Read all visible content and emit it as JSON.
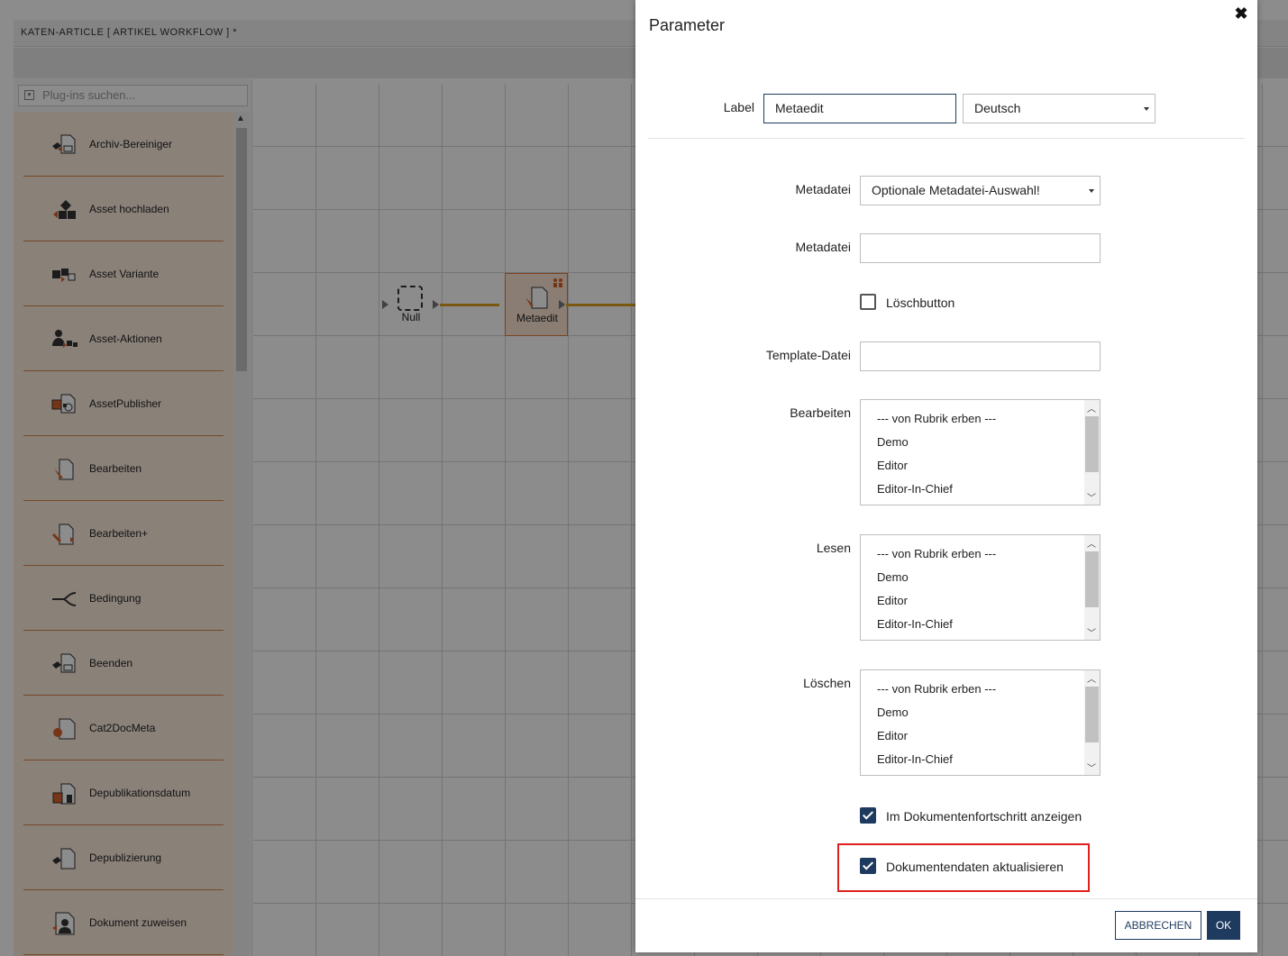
{
  "app": {
    "title": "KATEN-ARTICLE [ ARTIKEL WORKFLOW ] *"
  },
  "plugins": {
    "search_placeholder": "Plug-ins suchen...",
    "items": [
      {
        "label": "Archiv-Bereiniger",
        "icon": "archive-cleaner-icon"
      },
      {
        "label": "Asset hochladen",
        "icon": "asset-upload-icon"
      },
      {
        "label": "Asset Variante",
        "icon": "asset-variant-icon"
      },
      {
        "label": "Asset-Aktionen",
        "icon": "asset-actions-icon"
      },
      {
        "label": "AssetPublisher",
        "icon": "asset-publisher-icon"
      },
      {
        "label": "Bearbeiten",
        "icon": "edit-document-icon"
      },
      {
        "label": "Bearbeiten+",
        "icon": "edit-plus-document-icon"
      },
      {
        "label": "Bedingung",
        "icon": "condition-branch-icon"
      },
      {
        "label": "Beenden",
        "icon": "end-icon"
      },
      {
        "label": "Cat2DocMeta",
        "icon": "cat2docmeta-icon"
      },
      {
        "label": "Depublikationsdatum",
        "icon": "depublish-date-icon"
      },
      {
        "label": "Depublizierung",
        "icon": "depublish-icon"
      },
      {
        "label": "Dokument zuweisen",
        "icon": "assign-document-icon"
      }
    ]
  },
  "canvas": {
    "nodes": [
      {
        "label": "Null",
        "icon": "null-node-icon"
      },
      {
        "label": "Metaedit",
        "icon": "meta-edit-icon",
        "badge": "users-badge-icon"
      }
    ]
  },
  "dialog": {
    "title": "Parameter",
    "close_icon": "close-icon",
    "label_field": {
      "label": "Label",
      "value": "Metaedit"
    },
    "language_select": {
      "value": "Deutsch"
    },
    "metadatei_select": {
      "label": "Metadatei",
      "value": "Optionale Metadatei-Auswahl!"
    },
    "metadatei_input": {
      "label": "Metadatei",
      "value": ""
    },
    "loeschbutton": {
      "label": "Löschbutton",
      "checked": false
    },
    "template_file": {
      "label": "Template-Datei",
      "value": ""
    },
    "bearbeiten": {
      "label": "Bearbeiten",
      "options": [
        "--- von Rubrik erben ---",
        "Demo",
        "Editor",
        "Editor-In-Chief"
      ]
    },
    "lesen": {
      "label": "Lesen",
      "options": [
        "--- von Rubrik erben ---",
        "Demo",
        "Editor",
        "Editor-In-Chief"
      ]
    },
    "loeschen": {
      "label": "Löschen",
      "options": [
        "--- von Rubrik erben ---",
        "Demo",
        "Editor",
        "Editor-In-Chief"
      ]
    },
    "show_progress": {
      "label": "Im Dokumentenfortschritt anzeigen",
      "checked": true
    },
    "update_docdata": {
      "label": "Dokumentendaten aktualisieren",
      "checked": true
    },
    "cancel_label": "ABBRECHEN",
    "ok_label": "OK"
  },
  "colors": {
    "primary": "#1e3a5f",
    "accent": "#e07b39",
    "highlight": "#e0201e"
  }
}
